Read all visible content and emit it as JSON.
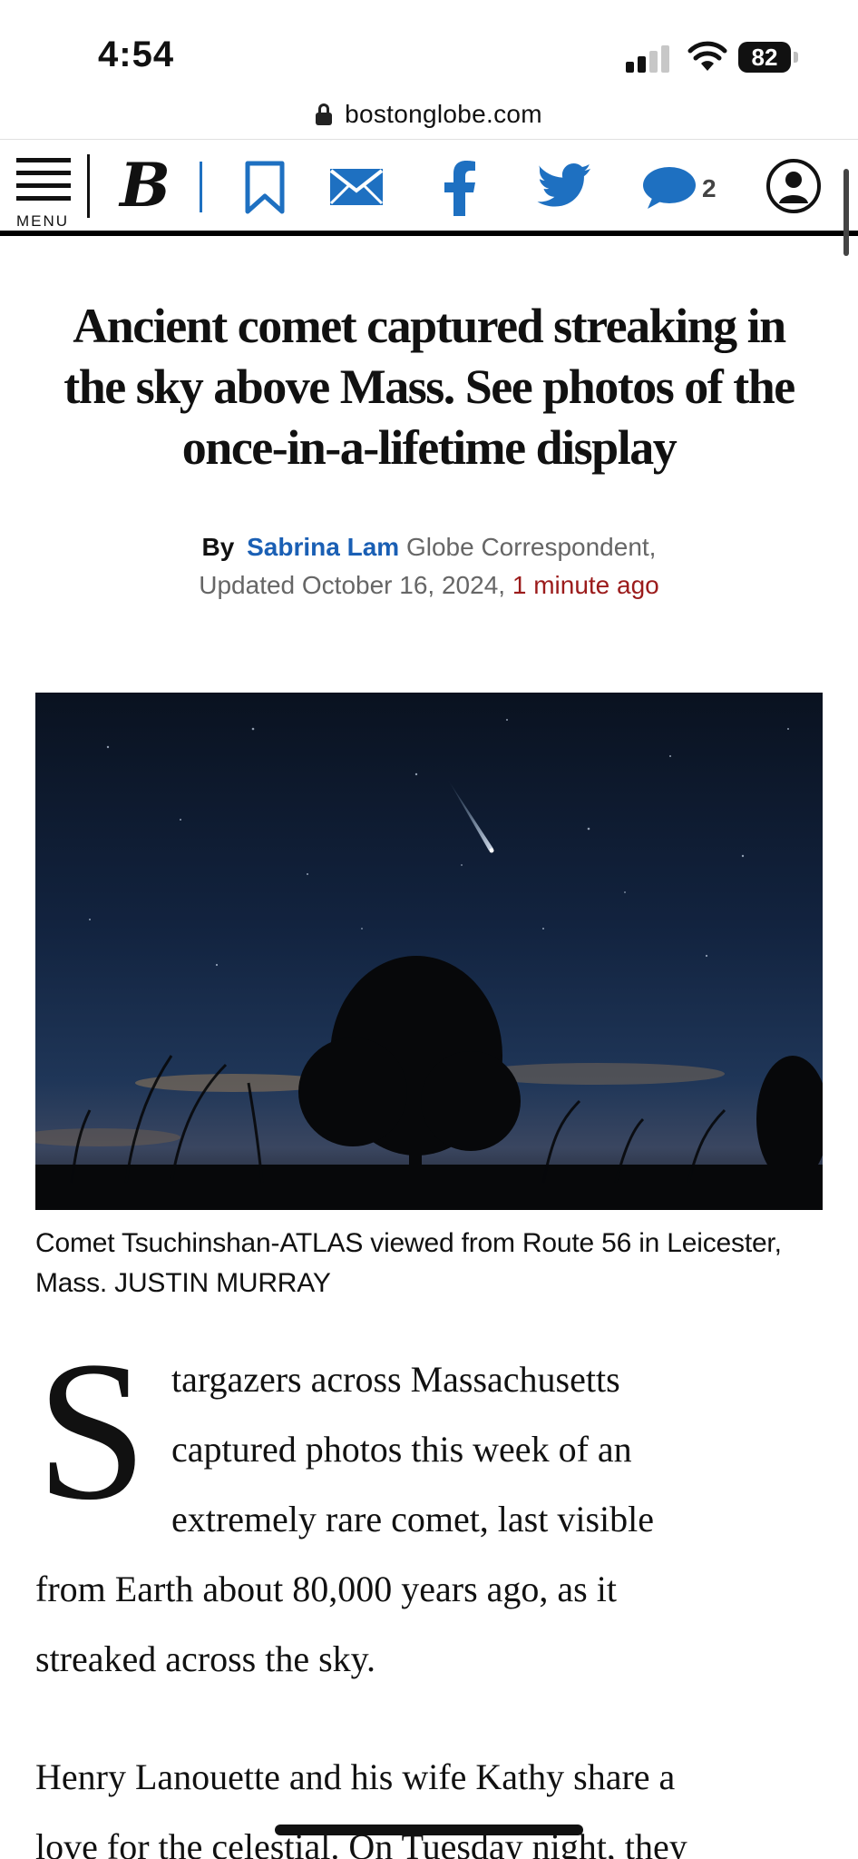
{
  "status_bar": {
    "time": "4:54",
    "battery": "82"
  },
  "browser": {
    "url": "bostonglobe.com"
  },
  "toolbar": {
    "menu_label": "MENU",
    "logo": "B",
    "comment_count": "2",
    "icons": [
      "menu-icon",
      "logo",
      "bookmark-icon",
      "email-icon",
      "facebook-icon",
      "twitter-icon",
      "comment-icon",
      "account-icon"
    ],
    "colors": {
      "brand_blue": "#1a5fb4",
      "icon_blue": "#1e70c1",
      "twitter_blue": "#1da1f2"
    }
  },
  "article": {
    "headline": "Ancient comet captured streaking in the sky above Mass. See photos of the once-in-a-lifetime display",
    "byline_by": "By",
    "author": "Sabrina Lam",
    "author_role": "Globe Correspondent,",
    "updated": "Updated October 16, 2024,",
    "updated_ago": "1 minute ago",
    "caption_line1": "Comet Tsuchinshan-ATLAS viewed from Route 56 in Leicester,",
    "caption_line2": "Mass.  JUSTIN MURRAY",
    "drop_cap": "S",
    "paragraph1_lines": [
      "targazers across Massachusetts",
      "captured photos this week of an",
      "extremely rare comet, last visible",
      "from Earth about 80,000 years ago, as it",
      "streaked across the sky."
    ],
    "paragraph2_lines": [
      "Henry Lanouette and his wife Kathy share a",
      "love for the celestial. On Tuesday night, they"
    ]
  }
}
